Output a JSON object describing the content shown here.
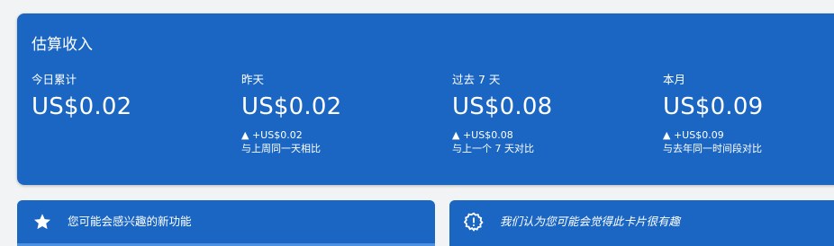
{
  "earnings": {
    "title": "估算收入",
    "metrics": [
      {
        "label": "今日累计",
        "value": "US$0.02",
        "delta": "",
        "compare": ""
      },
      {
        "label": "昨天",
        "value": "US$0.02",
        "delta": "▲ +US$0.02",
        "compare": "与上周同一天相比"
      },
      {
        "label": "过去 7 天",
        "value": "US$0.08",
        "delta": "▲ +US$0.08",
        "compare": "与上一个 7 天对比"
      },
      {
        "label": "本月",
        "value": "US$0.09",
        "delta": "▲ +US$0.09",
        "compare": "与去年同一时间段对比"
      }
    ]
  },
  "cards": {
    "features": {
      "title": "您可能会感兴趣的新功能",
      "icon": "star-icon"
    },
    "useful": {
      "title": "我们认为您可能会觉得此卡片很有趣",
      "icon": "gear-alert-icon"
    }
  },
  "colors": {
    "card_blue": "#1a66c2",
    "background": "#f1f3f4",
    "text": "#ffffff"
  }
}
